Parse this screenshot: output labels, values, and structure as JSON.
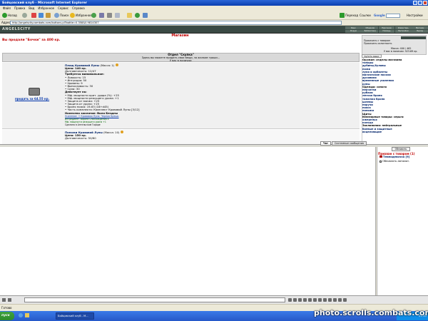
{
  "window": {
    "title": "Бойцовский клуб - Microsoft Internet Explorer"
  },
  "menu": [
    "Файл",
    "Правка",
    "Вид",
    "Избранное",
    "Сервис",
    "Справка"
  ],
  "toolbar": {
    "back": "Назад",
    "search": "Поиск",
    "favorites": "Избранное",
    "go": "Переход",
    "links": "Ссылки",
    "google": "Google",
    "settings": "Настройки"
  },
  "address": {
    "label": "Адрес",
    "url": "http://angelscity.combats.com/buttons.pl?battle=0.358&0.9814307"
  },
  "site": {
    "logo": "ANGELSCITY",
    "nav": [
      "Банк",
      "Общение",
      "Персонаж",
      "Инвентарь",
      "Магазин",
      "Форум",
      "Библиотека",
      "Помощь",
      "Настройки",
      "Выход"
    ]
  },
  "shop": {
    "title": "Магазин",
    "sold_message": "Вы продали \"Бочки\" за 400 кр.",
    "user_panel": [
      "Прокачать с товаром",
      "Прокачать склонность",
      "Масса: 400 / 462",
      "У вас в наличии: 523.69 кр."
    ],
    "small_btn": "Купить вещи",
    "dept_title": "Отдел \"Скупка\"",
    "dept_note": "Здесь вы можете продать свои вещи, за жалкие гроши...",
    "dept_count": "У вас в наличии:",
    "sell_link": "продать за 64.55 кр.",
    "item": {
      "name": "Плащ Кровавой Луны",
      "mass": "(Масса: 1)",
      "price": "Цена: 140 кр.",
      "durability": "Долговечность: 12/47",
      "req_title": "Требуется минимальное:",
      "reqs": [
        "• Ловкость: 15",
        "• Интуиция: 50",
        "• Уровень: 9",
        "• Выносливость: 30",
        "• Сила: 30"
      ],
      "acts_title": "Действует на:",
      "acts": [
        "• Мф. мощности крит. удара (%): +25",
        "• Мф. мощности режущего урона: +1",
        "• Защита от магии: +25",
        "• Защита от урона: +25",
        "• Броня пояса: 19-63 (18+d45)",
        "• Часть комплекта: Комплект Кровавой Луны [3/12]"
      ],
      "engraved": "Нанесено заклятие: Воля Бездны",
      "enhanced": "Усиление: + Кровавая Луна: Черная Брешь",
      "extra": [
        "Ингредиент: Ворота Снисхождения 4",
        "Мф. мощности режущего урона +1",
        "Сделано в Ангельском Городе"
      ]
    },
    "item2": {
      "name": "Поножи Кровавой Луны",
      "mass": "(Масса: 10)",
      "price": "Цена: 150 кр.",
      "durability": "Долговечность: 50/60"
    },
    "categories": [
      {
        "text": "Оружие: отделы магазина",
        "hdr": true
      },
      {
        "text": "   топоры"
      },
      {
        "text": "   дубины,булавы"
      },
      {
        "text": "   ножи"
      },
      {
        "text": "   луки и арбалеты"
      },
      {
        "text": "   магические посохи"
      },
      {
        "text": "   духовики"
      },
      {
        "text": "   временные усиления"
      },
      {
        "text": "   руны"
      },
      {
        "text": "Одежда: сапоги",
        "hdr": true
      },
      {
        "text": "   перчатки"
      },
      {
        "text": "   рубахи"
      },
      {
        "text": "   легкая броня"
      },
      {
        "text": "   тяжелая броня"
      },
      {
        "text": "   шлемы"
      },
      {
        "text": "   наручи"
      },
      {
        "text": "   пояса"
      },
      {
        "text": "   поножи"
      },
      {
        "text": "Щиты",
        "hdr": true
      },
      {
        "text": "Ювелирные товары: серьги",
        "hdr": true
      },
      {
        "text": "   ожерелья"
      },
      {
        "text": "   кольца"
      },
      {
        "text": "Заклинания: нейтральные",
        "hdr": true
      },
      {
        "text": "   боевые и защитные"
      },
      {
        "text": "   исцеляющие"
      }
    ]
  },
  "chat": {
    "tab_chat": "Чат",
    "tab_system": "Системные сообщения"
  },
  "side_chat": {
    "refresh": "Обновить",
    "title": "Призван с товаром (1)",
    "user": "Темнодевочка [9]",
    "auto": "Обновлять автомат."
  },
  "status": {
    "text": "Готово"
  },
  "taskbar": {
    "start": "пуск",
    "task": "Бойцовский клуб - M...",
    "time": "21:33"
  },
  "watermark": "photo.scrolls.combats.com"
}
